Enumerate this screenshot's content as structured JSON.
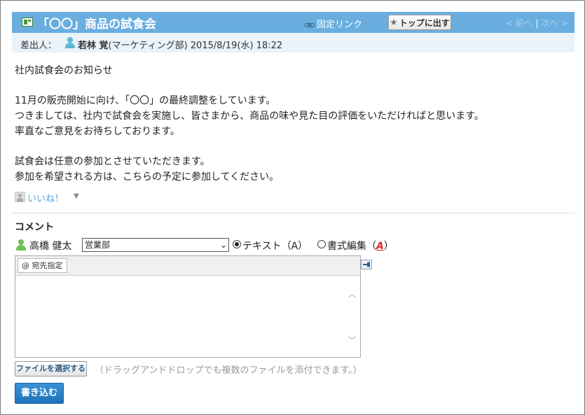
{
  "header": {
    "title": "「〇〇」商品の試食会",
    "permalink_label": "固定リンク",
    "to_top_label": "トップに出す",
    "prev_label": "< 前へ",
    "next_label": "次へ >",
    "title_bar_color": "#6aaee0"
  },
  "sender": {
    "label": "差出人：",
    "name": "若林 覚",
    "department": "(マーケティング部)",
    "datetime": "2015/8/19(水) 18:22"
  },
  "message": {
    "body": "社内試食会のお知らせ\n\n11月の販売開始に向け、「〇〇」の最終調整をしています。\nつきましては、社内で試食会を実施し、皆さまから、商品の味や見た目の評価をいただければと思います。\n率直なご意見をお待ちしております。\n\n試食会は任意の参加とさせていただきます。\n参加を希望される方は、こちらの予定に参加してください。"
  },
  "like": {
    "label": "いいね！"
  },
  "comment": {
    "heading": "コメント",
    "commenter_name": "高橋 健太",
    "department_selected": "営業部",
    "mode_text_label": "テキスト（A）",
    "mode_rich_label_prefix": "書式編集（",
    "mode_rich_label_icon": "A",
    "mode_rich_label_suffix": "）",
    "mode_selected": "text",
    "mention_button_label": "@ 宛先指定",
    "file_button_label": "ファイルを選択する",
    "file_hint": "（ドラッグアンドドロップでも複数のファイルを添付できます。）",
    "submit_label": "書き込む"
  }
}
